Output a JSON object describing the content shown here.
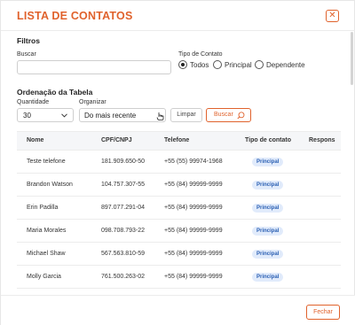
{
  "header": {
    "title": "LISTA DE CONTATOS",
    "close_icon": "close-icon"
  },
  "filters": {
    "section_title": "Filtros",
    "search_label": "Buscar",
    "search_value": "",
    "contact_type_label": "Tipo de Contato",
    "contact_type_options": [
      "Todos",
      "Principal",
      "Dependente"
    ],
    "contact_type_selected": "Todos"
  },
  "ordering": {
    "section_title": "Ordenação da Tabela",
    "quantity_label": "Quantidade",
    "quantity_value": "30",
    "organize_label": "Organizar",
    "organize_value": "Do mais recente",
    "clear_label": "Limpar",
    "search_button_label": "Buscar"
  },
  "table": {
    "columns": [
      "Nome",
      "CPF/CNPJ",
      "Telefone",
      "Tipo de contato",
      "Respons"
    ],
    "rows": [
      {
        "nome": "Teste telefone",
        "cpf": "181.909.650-50",
        "telefone": "+55 (55) 99974-1968",
        "tipo": "Principal"
      },
      {
        "nome": "Brandon Watson",
        "cpf": "104.757.307-55",
        "telefone": "+55 (84) 99999-9999",
        "tipo": "Principal"
      },
      {
        "nome": "Erin Padilla",
        "cpf": "897.077.291-04",
        "telefone": "+55 (84) 99999-9999",
        "tipo": "Principal"
      },
      {
        "nome": "Maria Morales",
        "cpf": "098.708.793-22",
        "telefone": "+55 (84) 99999-9999",
        "tipo": "Principal"
      },
      {
        "nome": "Michael Shaw",
        "cpf": "567.563.810-59",
        "telefone": "+55 (84) 99999-9999",
        "tipo": "Principal"
      },
      {
        "nome": "Molly Garcia",
        "cpf": "761.500.263-02",
        "telefone": "+55 (84) 99999-9999",
        "tipo": "Principal"
      }
    ]
  },
  "footer": {
    "close_label": "Fechar"
  },
  "colors": {
    "accent": "#e0622c",
    "badge_bg": "#e1ebfb",
    "badge_text": "#2a5fb3"
  }
}
